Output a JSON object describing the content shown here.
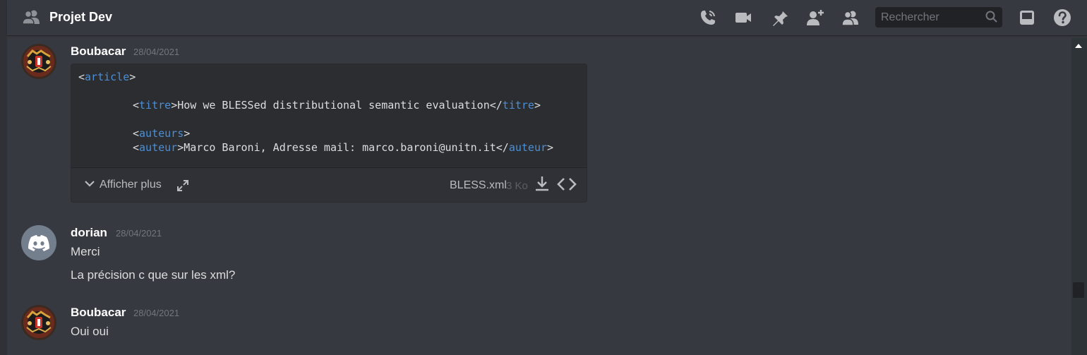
{
  "channel": {
    "title": "Projet Dev"
  },
  "toolbar": {
    "icons": [
      "phone-call-icon",
      "video-icon",
      "pin-icon",
      "add-member-icon",
      "members-icon",
      "inbox-icon",
      "help-icon"
    ]
  },
  "search": {
    "placeholder": "Rechercher"
  },
  "colors": {
    "background": "#36393f",
    "header_text": "#ffffff",
    "xml_tag": "#4b8fd6",
    "code_bg": "#2b2d31"
  },
  "messages": [
    {
      "author": "Boubacar",
      "timestamp": "28/04/2021",
      "attachment": {
        "code_lines": [
          {
            "pre": "<",
            "tag": "article",
            "mid": ">",
            "tag2": "",
            "post": ""
          },
          {
            "pre": "<",
            "tag": "titre",
            "mid": ">How we BLESSed distributional semantic evaluation</",
            "tag2": "titre",
            "post": ">"
          },
          {
            "pre": "<",
            "tag": "auteurs",
            "mid": ">",
            "tag2": "",
            "post": ""
          },
          {
            "pre": "<",
            "tag": "auteur",
            "mid": ">Marco Baroni, Adresse mail: marco.baroni@unitn.it</",
            "tag2": "auteur",
            "post": ">"
          }
        ],
        "show_more_label": "Afficher plus",
        "filename": "BLESS.xml",
        "filesize": "3 Ko"
      }
    },
    {
      "author": "dorian",
      "timestamp": "28/04/2021",
      "lines": [
        "Merci",
        "La précision c que sur les xml?"
      ]
    },
    {
      "author": "Boubacar",
      "timestamp": "28/04/2021",
      "lines": [
        "Oui oui"
      ]
    }
  ]
}
